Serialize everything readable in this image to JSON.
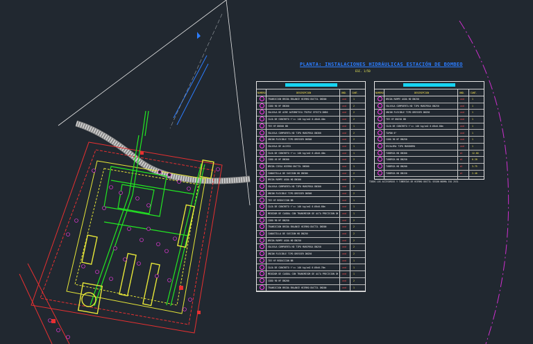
{
  "drawing": {
    "title": "PLANTA: INSTALACIONES HIDRÁULICAS ESTACIÓN DE BOMBEO",
    "scale": "ESC. 1/50",
    "note": "TODOS LOS ACCESORIOS Y TUBERÍAS DE HIERRO DÚCTIL SEGÚN NORMA ISO 2531",
    "colors": {
      "background": "#212830",
      "table_border": "#e6e6e6",
      "header_bar": "#16d4f2",
      "title": "#2c7dff",
      "marker": "#ff3cf0",
      "unit_text": "#ff5050",
      "qty_text": "#ffee55",
      "pipe_green": "#22e822",
      "pipe_yellow": "#e8e838",
      "wall_red": "#e83030"
    }
  },
  "left_table": {
    "headers": [
      "NÚMERO",
      "DESCRIPCIÓN",
      "UND.",
      "CANT."
    ],
    "rows": [
      {
        "desc": "TRANSICIÓN BRIDA ENLANCE HIERRO DÚCTIL DN300",
        "unit": "und",
        "qty": "1"
      },
      {
        "desc": "CODO 90 HF DN300",
        "unit": "und",
        "qty": "2"
      },
      {
        "desc": "VALVULA DE AIRE AUTOMÁTICA TRIPLE EFECTO DN50",
        "unit": "und",
        "qty": "2"
      },
      {
        "desc": "CAJA DE CONCRETO f'c= 140 kg/cm2 0.40x0.40m",
        "unit": "und",
        "qty": "2"
      },
      {
        "desc": "TEE HF DN300 BB",
        "unit": "und",
        "qty": "1"
      },
      {
        "desc": "VÁLVULA COMPUERTA HD TIPO MARIPOSA DN300",
        "unit": "und",
        "qty": "2"
      },
      {
        "desc": "UNIÓN FLEXIBLE TIPO DRESSER DN300",
        "unit": "und",
        "qty": "2"
      },
      {
        "desc": "VÁLVULA DE ALIVIO",
        "unit": "und",
        "qty": "1"
      },
      {
        "desc": "CAJA DE CONCRETO f'c= 140 kg/cm2 0.40x0.40m",
        "unit": "und",
        "qty": "1"
      },
      {
        "desc": "CODO 45 HF DN300",
        "unit": "und",
        "qty": "2"
      },
      {
        "desc": "BRIDA CIEGA HIERRO DÚCTIL DN300",
        "unit": "und",
        "qty": "1"
      },
      {
        "desc": "CANASTILLA DE SUCCIÓN HD DN300",
        "unit": "und",
        "qty": "2"
      },
      {
        "desc": "BRIDA ROMPE AGUA HD DN300",
        "unit": "und",
        "qty": "2"
      },
      {
        "desc": "VÁLVULA COMPUERTA HD TIPO MARIPOSA DN300",
        "unit": "und",
        "qty": "2"
      },
      {
        "desc": "UNIÓN FLEXIBLE TIPO DRESSER DN300",
        "unit": "und",
        "qty": "2"
      },
      {
        "desc": "TEE HF REDUCCIÓN BB",
        "unit": "und",
        "qty": "1"
      },
      {
        "desc": "CAJA DE CONCRETO f'c= 140 kg/cm2 0.60x0.60m",
        "unit": "und",
        "qty": "1"
      },
      {
        "desc": "MEDIDOR DE CAUDAL CON TRANSMISOR DE ALTA PRECISIÓN DN300",
        "unit": "und",
        "qty": "1"
      },
      {
        "desc": "CODO 90 HF DN250",
        "unit": "und",
        "qty": "2"
      },
      {
        "desc": "TRANSICIÓN BRIDA ENLANCE HIERRO DÚCTIL DN300",
        "unit": "und",
        "qty": "2"
      },
      {
        "desc": "CANASTILLA DE SUCCIÓN HD DN250",
        "unit": "und",
        "qty": "2"
      },
      {
        "desc": "BRIDA ROMPE AGUA HD DN250",
        "unit": "und",
        "qty": "2"
      },
      {
        "desc": "VÁLVULA COMPUERTA HD TIPO MARIPOSA DN250",
        "unit": "und",
        "qty": "2"
      },
      {
        "desc": "UNIÓN FLEXIBLE TIPO DRESSER DN250",
        "unit": "und",
        "qty": "2"
      },
      {
        "desc": "TEE HF REDUCCIÓN BB",
        "unit": "und",
        "qty": "1"
      },
      {
        "desc": "CAJA DE CONCRETO f'c= 140 kg/cm2 0.60x0.70m",
        "unit": "und",
        "qty": "1"
      },
      {
        "desc": "MEDIDOR DE CAUDAL CON TRANSMISOR DE ALTA PRECISIÓN DN250",
        "unit": "und",
        "qty": "1"
      },
      {
        "desc": "CODO 90 HF DN200",
        "unit": "und",
        "qty": "2"
      },
      {
        "desc": "TRANSICIÓN BRIDA ENLANCE HIERRO DÚCTIL DN200",
        "unit": "und",
        "qty": "1"
      }
    ]
  },
  "right_table": {
    "headers": [
      "NÚMERO",
      "DESCRIPCIÓN",
      "UND.",
      "CANT."
    ],
    "rows": [
      {
        "desc": "BRIDA ROMPE AGUA HD DN250",
        "unit": "und",
        "qty": "1"
      },
      {
        "desc": "VÁLVULA COMPUERTA HD TIPO MARIPOSA DN250",
        "unit": "und",
        "qty": "1"
      },
      {
        "desc": "UNIÓN FLEXIBLE TIPO DRESSER DN250",
        "unit": "und",
        "qty": "1"
      },
      {
        "desc": "TEE HF DN250 BB",
        "unit": "und",
        "qty": "1"
      },
      {
        "desc": "CAJA DE CONCRETO f'c= 140 kg/cm2 0.60x0.60m",
        "unit": "und",
        "qty": "1"
      },
      {
        "desc": "TAPÓN 6\"",
        "unit": "und",
        "qty": "1"
      },
      {
        "desc": "CODO 90 HF DN250",
        "unit": "und",
        "qty": "1"
      },
      {
        "desc": "ESCALERA TIPO MARINERO",
        "unit": "und",
        "qty": "1"
      },
      {
        "desc": "TUBERÍA HD DN300",
        "unit": "ml",
        "qty": "12.60"
      },
      {
        "desc": "TUBERÍA HD DN250",
        "unit": "ml",
        "qty": "6.20"
      },
      {
        "desc": "TUBERÍA HD DN200",
        "unit": "ml",
        "qty": "3.75"
      },
      {
        "desc": "TUBERÍA HD DN150",
        "unit": "ml",
        "qty": "2.40"
      }
    ]
  }
}
